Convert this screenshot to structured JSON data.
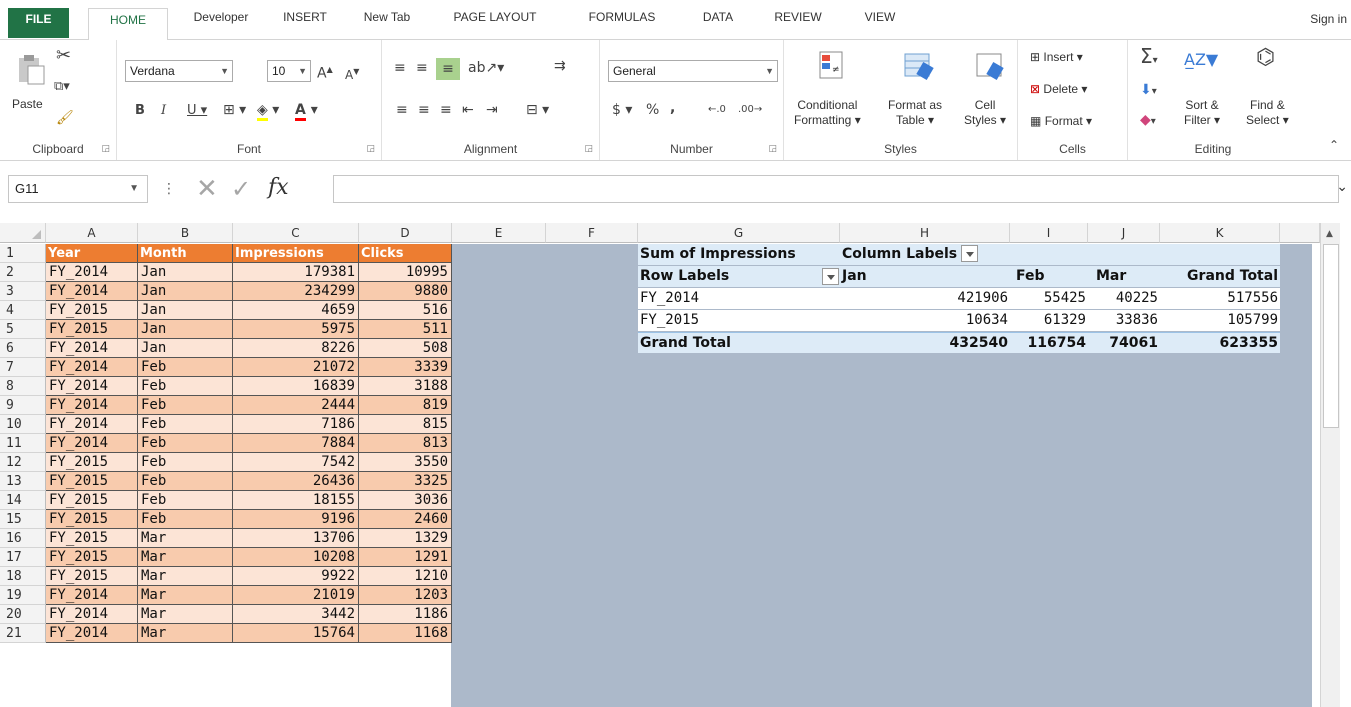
{
  "tabs": [
    "FILE",
    "HOME",
    "Developer",
    "INSERT",
    "New Tab",
    "PAGE LAYOUT",
    "FORMULAS",
    "DATA",
    "REVIEW",
    "VIEW"
  ],
  "signin": "Sign in",
  "ribbon": {
    "clipboard": {
      "label": "Clipboard",
      "paste": "Paste"
    },
    "font": {
      "label": "Font",
      "name": "Verdana",
      "size": "10"
    },
    "alignment": {
      "label": "Alignment"
    },
    "number": {
      "label": "Number",
      "format": "General",
      "currency": "$",
      "percent": "%",
      "comma": ","
    },
    "styles": {
      "label": "Styles",
      "cond1": "Conditional",
      "cond2": "Formatting",
      "fmt1": "Format as",
      "fmt2": "Table",
      "cell1": "Cell",
      "cell2": "Styles"
    },
    "cells": {
      "label": "Cells",
      "insert": "Insert",
      "delete": "Delete",
      "format": "Format"
    },
    "editing": {
      "label": "Editing",
      "sort1": "Sort &",
      "sort2": "Filter",
      "find1": "Find &",
      "find2": "Select"
    }
  },
  "formula_bar": {
    "name_box": "G11",
    "fx": "fx",
    "value": ""
  },
  "columns": [
    "A",
    "B",
    "C",
    "D",
    "E",
    "F",
    "G",
    "H",
    "I",
    "J",
    "K"
  ],
  "rows": [
    "1",
    "2",
    "3",
    "4",
    "5",
    "6",
    "7",
    "8",
    "9",
    "10",
    "11",
    "12",
    "13",
    "14",
    "15",
    "16",
    "17",
    "18",
    "19",
    "20",
    "21"
  ],
  "table": {
    "headers": [
      "Year",
      "Month",
      "Impressions",
      "Clicks"
    ],
    "data": [
      [
        "FY_2014",
        "Jan",
        "179381",
        "10995"
      ],
      [
        "FY_2014",
        "Jan",
        "234299",
        "9880"
      ],
      [
        "FY_2015",
        "Jan",
        "4659",
        "516"
      ],
      [
        "FY_2015",
        "Jan",
        "5975",
        "511"
      ],
      [
        "FY_2014",
        "Jan",
        "8226",
        "508"
      ],
      [
        "FY_2014",
        "Feb",
        "21072",
        "3339"
      ],
      [
        "FY_2014",
        "Feb",
        "16839",
        "3188"
      ],
      [
        "FY_2014",
        "Feb",
        "2444",
        "819"
      ],
      [
        "FY_2014",
        "Feb",
        "7186",
        "815"
      ],
      [
        "FY_2014",
        "Feb",
        "7884",
        "813"
      ],
      [
        "FY_2015",
        "Feb",
        "7542",
        "3550"
      ],
      [
        "FY_2015",
        "Feb",
        "26436",
        "3325"
      ],
      [
        "FY_2015",
        "Feb",
        "18155",
        "3036"
      ],
      [
        "FY_2015",
        "Feb",
        "9196",
        "2460"
      ],
      [
        "FY_2015",
        "Mar",
        "13706",
        "1329"
      ],
      [
        "FY_2015",
        "Mar",
        "10208",
        "1291"
      ],
      [
        "FY_2015",
        "Mar",
        "9922",
        "1210"
      ],
      [
        "FY_2014",
        "Mar",
        "21019",
        "1203"
      ],
      [
        "FY_2014",
        "Mar",
        "3442",
        "1186"
      ],
      [
        "FY_2014",
        "Mar",
        "15764",
        "1168"
      ]
    ]
  },
  "pivot": {
    "value_label": "Sum of Impressions",
    "column_labels": "Column Labels",
    "row_labels": "Row Labels",
    "col_headers": [
      "Jan",
      "Feb",
      "Mar",
      "Grand Total"
    ],
    "rows": [
      {
        "label": "FY_2014",
        "values": [
          "421906",
          "55425",
          "40225",
          "517556"
        ]
      },
      {
        "label": "FY_2015",
        "values": [
          "10634",
          "61329",
          "33836",
          "105799"
        ]
      }
    ],
    "total": {
      "label": "Grand Total",
      "values": [
        "432540",
        "116754",
        "74061",
        "623355"
      ]
    }
  },
  "colors": {
    "file_tab": "#217346",
    "header_orange": "#ed7d31",
    "band_dark": "#f8cbad",
    "band_light": "#fce4d6",
    "pivot_header": "#ddebf7",
    "sheet_bg": "#acb9ca"
  }
}
